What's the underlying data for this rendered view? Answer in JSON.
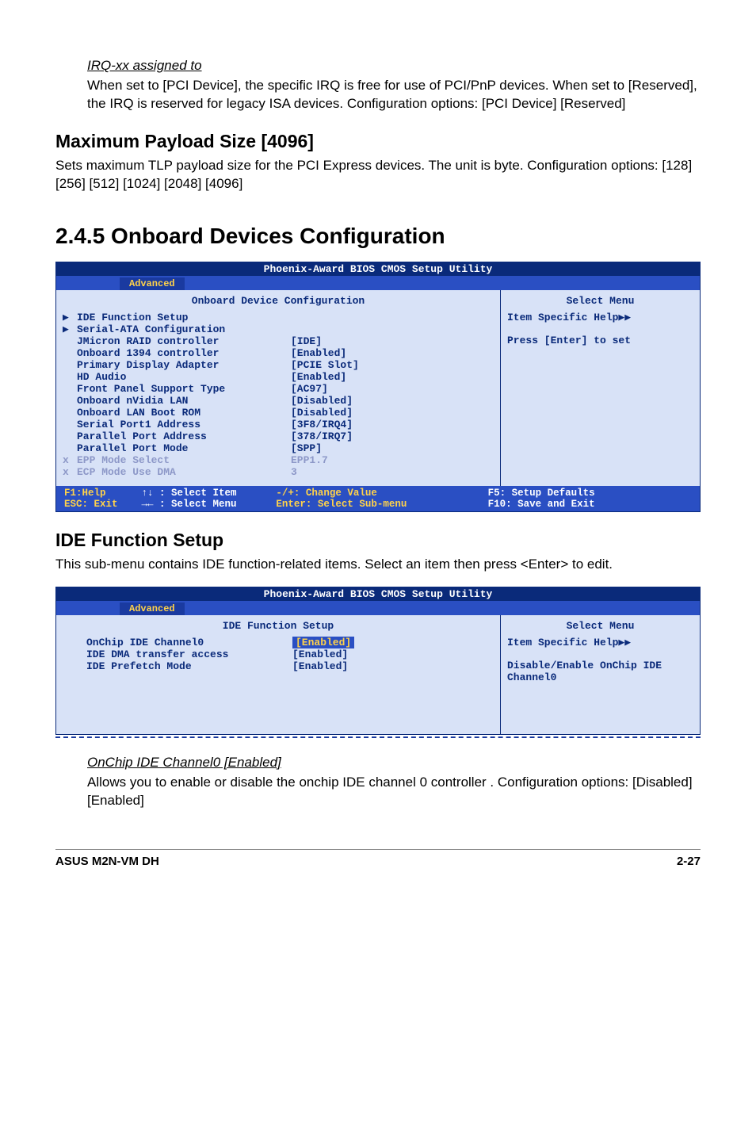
{
  "irq": {
    "title": "IRQ-xx assigned to",
    "text": "When set to [PCI Device], the specific IRQ is free for use of PCI/PnP devices. When set to [Reserved], the IRQ is reserved for legacy ISA devices. Configuration options: [PCI Device] [Reserved]"
  },
  "maxpayload": {
    "title": "Maximum Payload Size [4096]",
    "text": "Sets maximum TLP payload size for the PCI Express devices. The unit is byte. Configuration options: [128] [256] [512] [1024] [2048] [4096]"
  },
  "section_num_title": "2.4.5   Onboard Devices Configuration",
  "bios_util_title": "Phoenix-Award BIOS CMOS Setup Utility",
  "tab_label": "Advanced",
  "select_menu": "Select Menu",
  "panel1": {
    "header": "Onboard Device Configuration",
    "rows": [
      {
        "arrow": "▶",
        "label": "IDE Function Setup",
        "value": ""
      },
      {
        "arrow": "▶",
        "label": "Serial-ATA Configuration",
        "value": ""
      },
      {
        "arrow": "",
        "label": "JMicron RAID controller",
        "value": "[IDE]"
      },
      {
        "arrow": "",
        "label": "Onboard 1394 controller",
        "value": "[Enabled]"
      },
      {
        "arrow": "",
        "label": "Primary Display Adapter",
        "value": "[PCIE Slot]"
      },
      {
        "arrow": "",
        "label": "HD Audio",
        "value": "[Enabled]"
      },
      {
        "arrow": "",
        "label": "Front Panel Support Type",
        "value": "[AC97]"
      },
      {
        "arrow": "",
        "label": "Onboard nVidia LAN",
        "value": "[Disabled]"
      },
      {
        "arrow": "",
        "label": "Onboard LAN Boot ROM",
        "value": "[Disabled]"
      },
      {
        "arrow": "",
        "label": "Serial Port1 Address",
        "value": "[3F8/IRQ4]"
      },
      {
        "arrow": "",
        "label": "Parallel Port Address",
        "value": "[378/IRQ7]"
      },
      {
        "arrow": "",
        "label": "Parallel Port Mode",
        "value": "[SPP]"
      },
      {
        "arrow": "x",
        "label": "EPP Mode Select",
        "value": "EPP1.7",
        "dim": true
      },
      {
        "arrow": "x",
        "label": "ECP Mode Use DMA",
        "value": "3",
        "dim": true
      }
    ],
    "help_line1": "Item Specific Help▶▶",
    "help_line2": "Press [Enter] to set"
  },
  "bios_footer": {
    "c1a": "F1:Help",
    "c1b": "ESC: Exit",
    "c2a": "↑↓ : Select Item",
    "c2b": "→← : Select Menu",
    "c3a": "-/+: Change Value",
    "c3b": "Enter: Select Sub-menu",
    "c4a": "F5: Setup Defaults",
    "c4b": "F10: Save and Exit"
  },
  "ide": {
    "title": "IDE Function Setup",
    "text": "This sub-menu contains IDE function-related items. Select an item then press <Enter> to edit."
  },
  "panel2": {
    "header": "IDE Function Setup",
    "rows": [
      {
        "label": "OnChip IDE Channel0",
        "value": "[Enabled]",
        "hl": true
      },
      {
        "label": "IDE DMA transfer access",
        "value": "[Enabled]"
      },
      {
        "label": "IDE Prefetch Mode",
        "value": "[Enabled]"
      }
    ],
    "help_line1": "Item Specific Help▶▶",
    "help_line2": "Disable/Enable OnChip IDE Channel0"
  },
  "onchip": {
    "title": "OnChip IDE Channel0 [Enabled]",
    "text": "Allows you to enable or disable the onchip IDE channel 0 controller . Configuration options: [Disabled] [Enabled]"
  },
  "footer_left": "ASUS M2N-VM DH",
  "footer_right": "2-27"
}
